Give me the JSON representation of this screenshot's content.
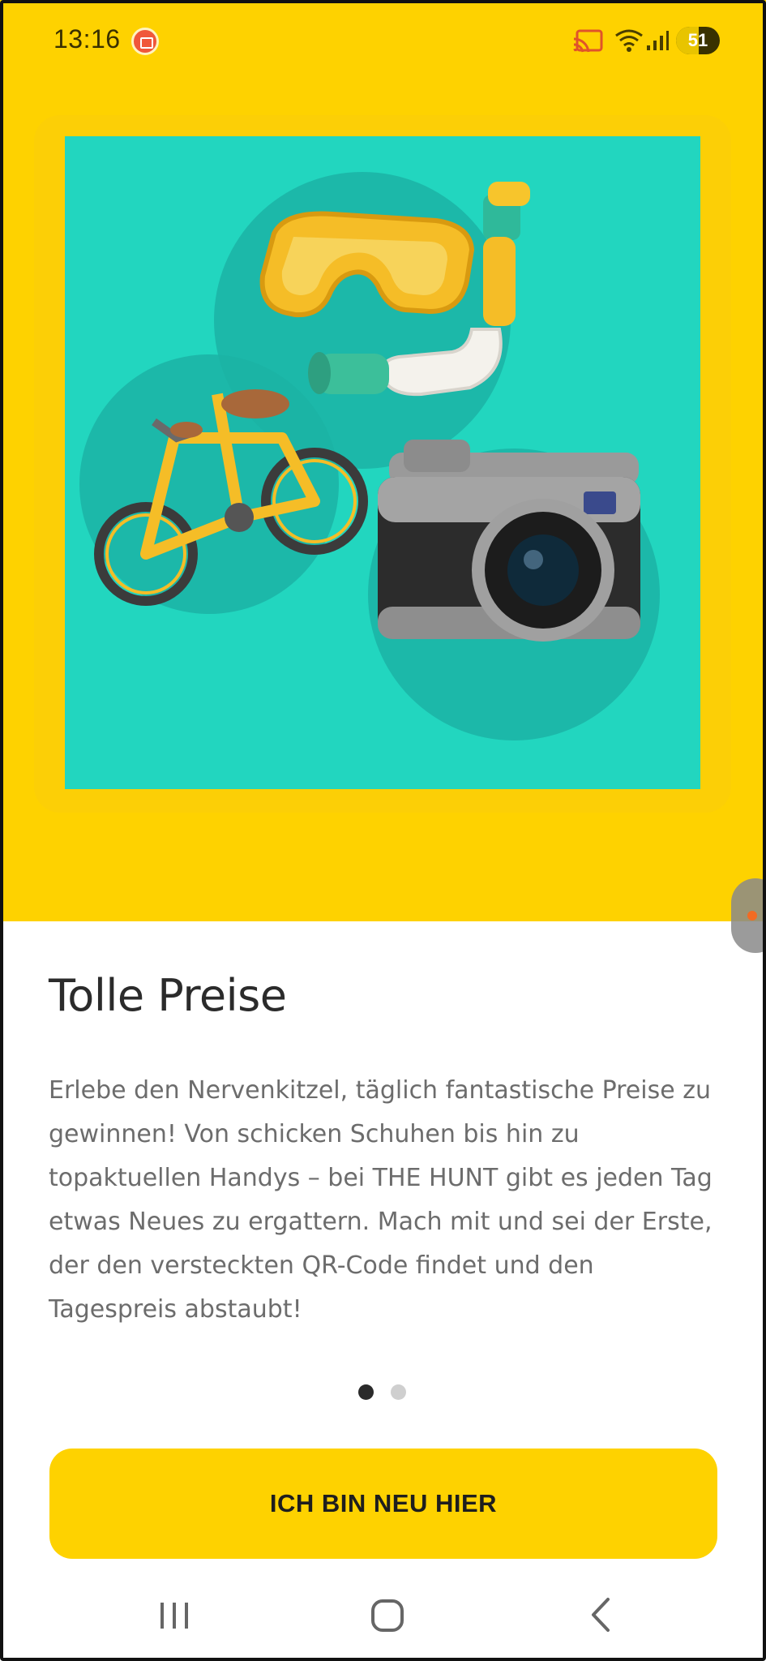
{
  "status_bar": {
    "time": "13:16",
    "battery_level": "51",
    "battery_fraction": 0.51,
    "icons": [
      "screen-record-icon",
      "cast-icon",
      "wifi-icon",
      "signal-icon",
      "battery-icon"
    ]
  },
  "onboarding": {
    "title": "Tolle Preise",
    "description": "Erlebe den Nervenkitzel, täglich fantastische Preise zu gewinnen! Von schicken Schuhen bis hin zu topaktuellen Handys – bei THE HUNT gibt es jeden Tag etwas Neues zu ergattern. Mach mit und sei der Erste, der den versteckten QR-Code findet und den Tagespreis abstaubt!",
    "illustration_items": [
      "snorkel-mask-icon",
      "bicycle-icon",
      "camera-icon"
    ],
    "page_indicator": {
      "current": 1,
      "total": 2
    },
    "cta_label": "ICH BIN NEU HIER"
  },
  "nav_bar": {
    "buttons": [
      "recents-button",
      "home-button",
      "back-button"
    ]
  },
  "colors": {
    "brand_yellow": "#fed200",
    "illustration_bg": "#22d6bf",
    "title": "#2b2b2b",
    "body": "#6c6c6c"
  }
}
